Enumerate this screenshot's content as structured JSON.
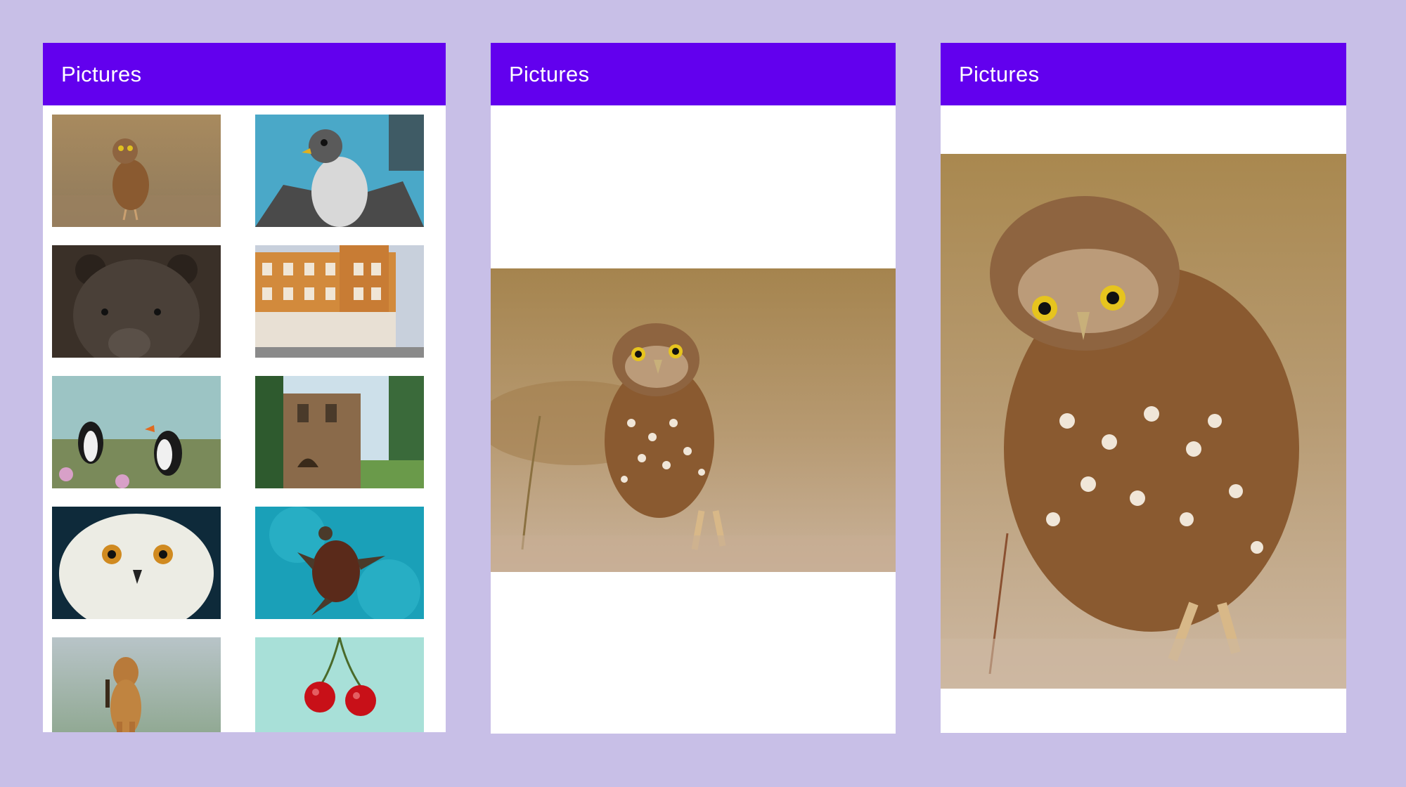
{
  "screens": [
    {
      "app_bar": {
        "title": "Pictures"
      }
    },
    {
      "app_bar": {
        "title": "Pictures"
      }
    },
    {
      "app_bar": {
        "title": "Pictures"
      }
    }
  ],
  "grid": {
    "items": [
      {
        "subject": "burrowing-owl"
      },
      {
        "subject": "falcon"
      },
      {
        "subject": "bear"
      },
      {
        "subject": "building"
      },
      {
        "subject": "puffins"
      },
      {
        "subject": "castle-ruin"
      },
      {
        "subject": "snowy-owl"
      },
      {
        "subject": "sea-turtle"
      },
      {
        "subject": "lion-cub"
      },
      {
        "subject": "cherries"
      }
    ]
  },
  "colors": {
    "background": "#c8bfe7",
    "app_bar": "#6200ee",
    "app_bar_text": "#ffffff",
    "surface": "#ffffff"
  }
}
